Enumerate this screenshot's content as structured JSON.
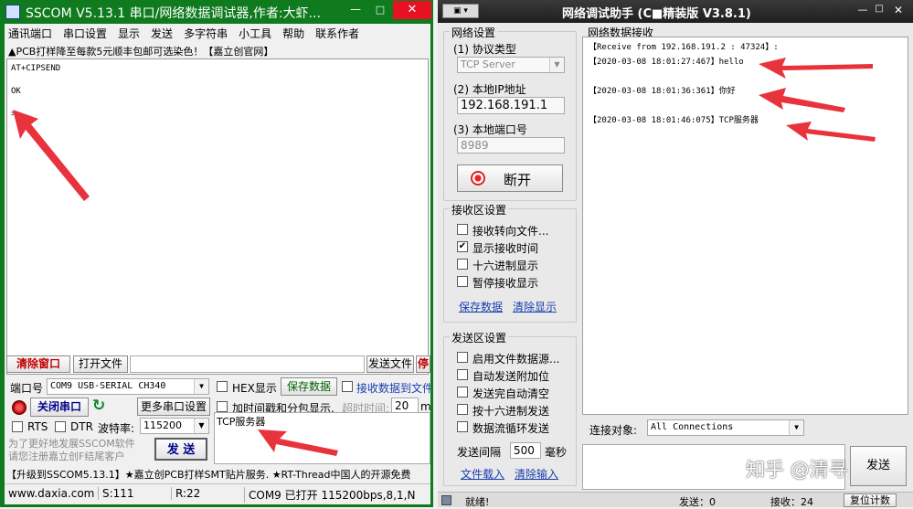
{
  "sscom": {
    "title": "SSCOM V5.13.1 串口/网络数据调试器,作者:大虾...",
    "menu": [
      "通讯端口",
      "串口设置",
      "显示",
      "发送",
      "多字符串",
      "小工具",
      "帮助",
      "联系作者"
    ],
    "ad": "▲PCB打样降至每款5元顺丰包邮可选染色！【嘉立创官网】",
    "terminal": [
      "AT+CIPSEND",
      "",
      "OK",
      "",
      ">"
    ],
    "clear_btn": "清除窗口",
    "open_file_btn": "打开文件",
    "send_file_btn": "发送文件",
    "stop_btn": "停",
    "port_label": "端口号",
    "port_value": "COM9 USB-SERIAL CH340",
    "hex_display": "HEX显示",
    "save_data": "保存数据",
    "recv_to_file": "接收数据到文件",
    "close_port": "关闭串口",
    "more_settings": "更多串口设置",
    "timestamp_label": "加时间戳和分包显示,",
    "timeout_label": "超时时间:",
    "timeout_value": "20",
    "timeout_unit": "ms",
    "rts": "RTS",
    "dtr": "DTR",
    "baud_label": "波特率:",
    "baud_value": "115200",
    "send_text": "TCP服务器",
    "send_btn": "发 送",
    "promo1": "为了更好地发展SSCOM软件",
    "promo2": "请您注册嘉立创F结尾客户",
    "ticker": "【升级到SSCOM5.13.1】★嘉立创PCB打样SMT贴片服务. ★RT-Thread中国人的开源免费",
    "status": [
      "www.daxia.com",
      "S:111",
      "R:22",
      "COM9 已打开  115200bps,8,1,N"
    ]
  },
  "netassist": {
    "title": "网络调试助手  (C■精装版 V3.8.1)",
    "net_settings": "网络设置",
    "protocol_label": "(1) 协议类型",
    "protocol_value": "TCP Server",
    "ip_label": "(2) 本地IP地址",
    "ip_value": "192.168.191.1",
    "port_label": "(3) 本地端口号",
    "port_value": "8989",
    "disconnect": "断开",
    "recv_settings": "接收区设置",
    "recv_options": [
      {
        "label": "接收转向文件...",
        "checked": false
      },
      {
        "label": "显示接收时间",
        "checked": true
      },
      {
        "label": "十六进制显示",
        "checked": false
      },
      {
        "label": "暂停接收显示",
        "checked": false
      }
    ],
    "save_data": "保存数据",
    "clear_display": "清除显示",
    "send_settings": "发送区设置",
    "send_options": [
      {
        "label": "启用文件数据源...",
        "checked": false
      },
      {
        "label": "自动发送附加位",
        "checked": false
      },
      {
        "label": "发送完自动清空",
        "checked": false
      },
      {
        "label": "按十六进制发送",
        "checked": false
      },
      {
        "label": "数据流循环发送",
        "checked": false
      }
    ],
    "interval_label": "发送间隔",
    "interval_value": "500",
    "interval_unit": "毫秒",
    "file_load": "文件载入",
    "clear_input": "清除输入",
    "recv_title": "网络数据接收",
    "recv_lines": [
      "【Receive from 192.168.191.2 : 47324】:",
      "【2020-03-08 18:01:27:467】hello",
      "",
      "【2020-03-08 18:01:36:361】你好",
      "",
      "【2020-03-08 18:01:46:075】TCP服务器"
    ],
    "connect_label": "连接对象:",
    "connect_value": "All Connections",
    "send_btn": "发送",
    "watermark": "知乎 @清寻",
    "status_ready": "就绪!",
    "status_sent": "发送：0",
    "status_recv": "接收：24",
    "reset_count": "复位计数"
  },
  "colors": {
    "sscom_title": "#0f7a1e",
    "net_title": "#2b2b2b",
    "arrow": "#e8323c",
    "link": "#1a3fb0"
  }
}
